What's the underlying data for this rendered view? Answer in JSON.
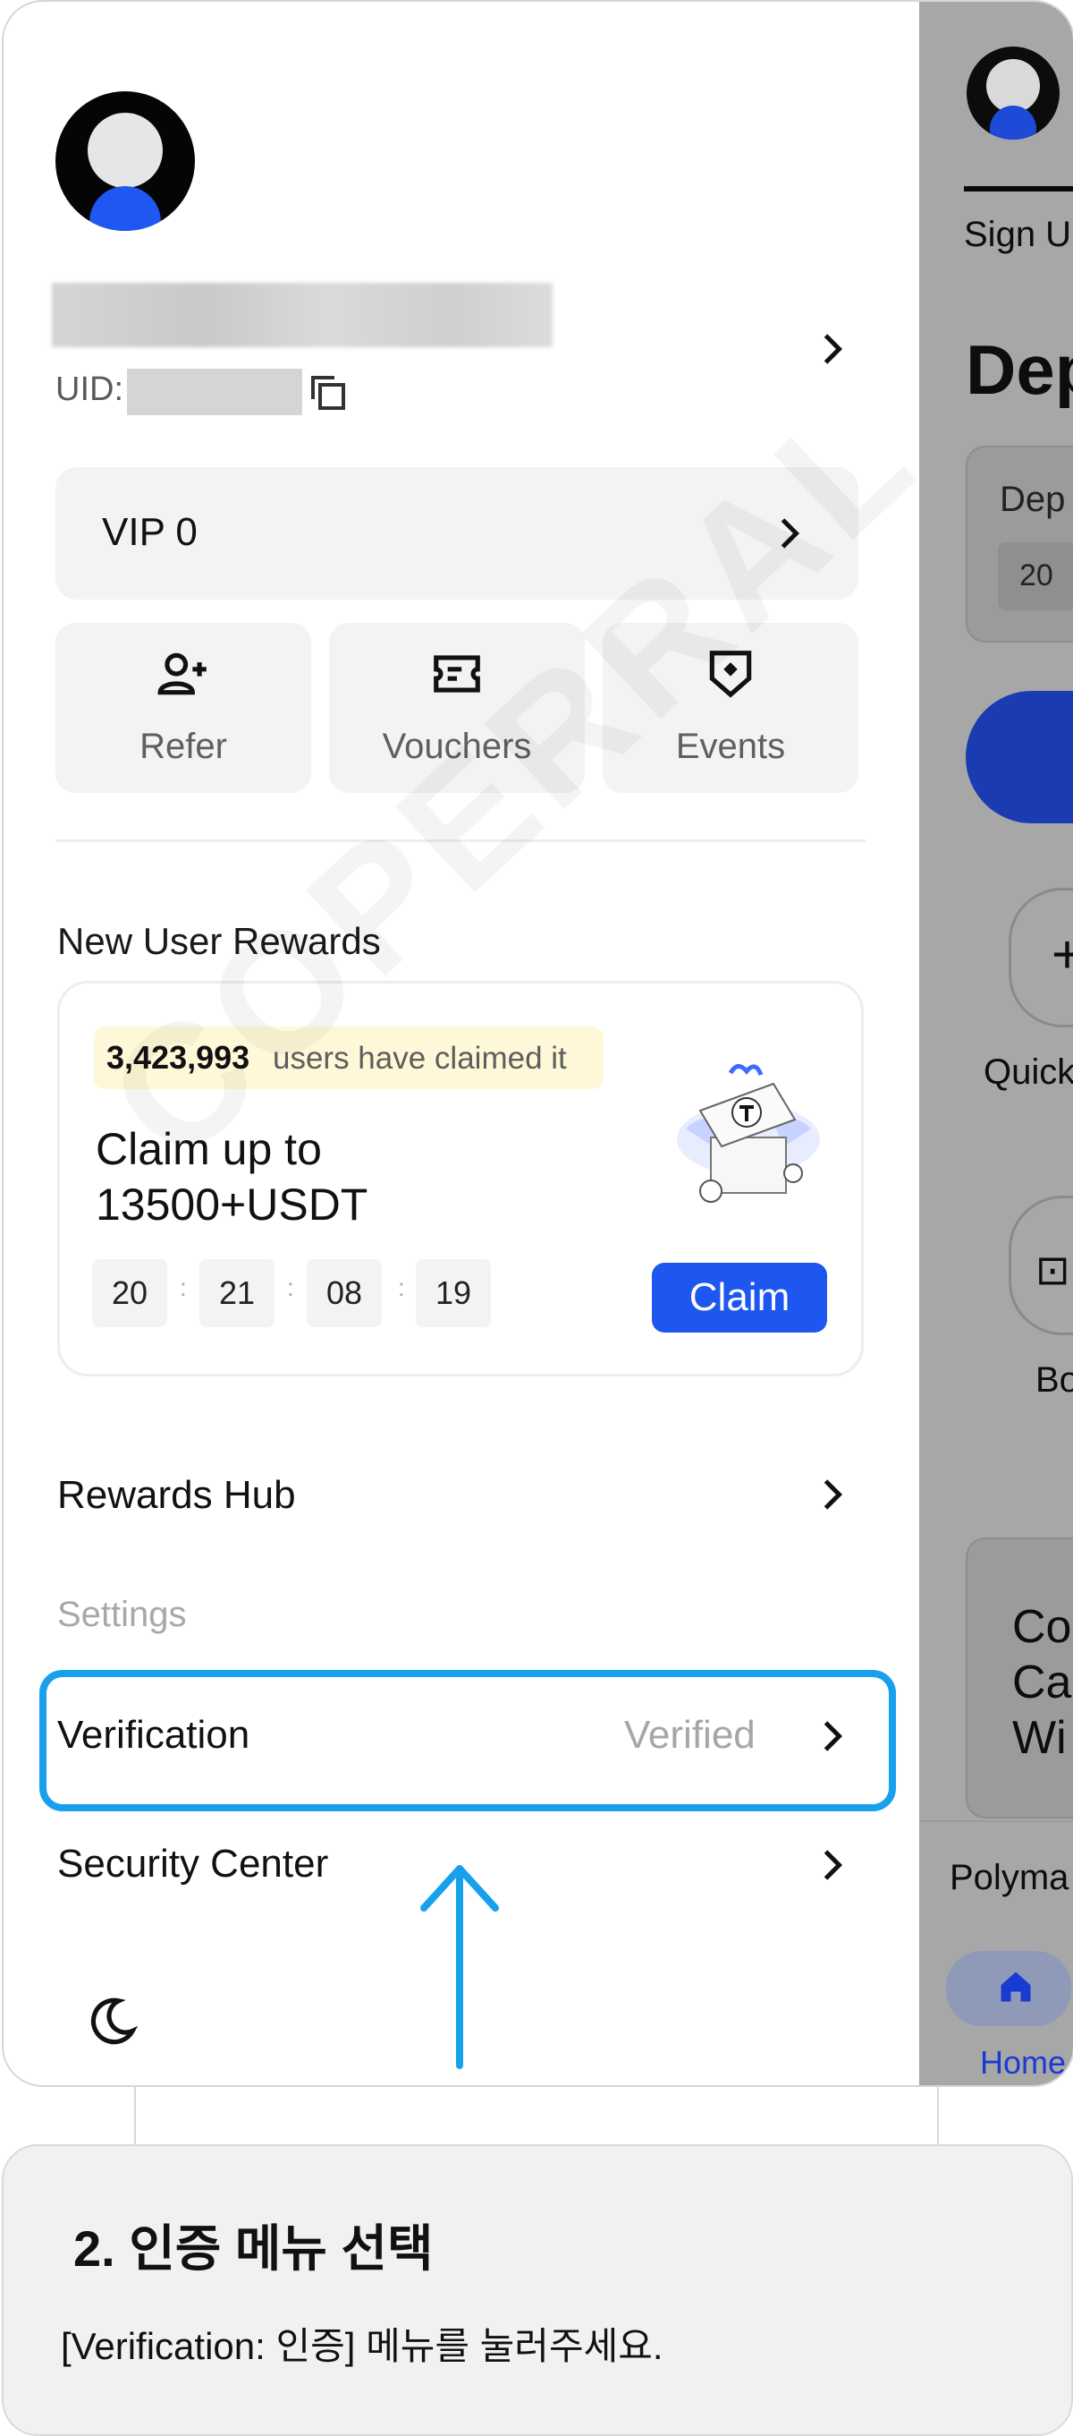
{
  "drawer": {
    "uid_label": "UID:",
    "vip_label": "VIP 0",
    "shortcuts": [
      {
        "label": "Refer",
        "icon": "user-plus-icon"
      },
      {
        "label": "Vouchers",
        "icon": "ticket-icon"
      },
      {
        "label": "Events",
        "icon": "badge-icon"
      }
    ],
    "new_user_rewards": {
      "title": "New User Rewards",
      "claimed_count": "3,423,993",
      "claimed_text": "users have claimed it",
      "headline": "Claim up to 13500+USDT",
      "timer": [
        "20",
        "21",
        "08",
        "19"
      ],
      "claim_button": "Claim"
    },
    "rewards_hub": "Rewards Hub",
    "settings_header": "Settings",
    "verification": {
      "label": "Verification",
      "status": "Verified"
    },
    "security_center": "Security Center"
  },
  "background_app": {
    "tab_label": "Sign Up",
    "heading": "Dep",
    "card_label": "Dep",
    "card_value": "20",
    "quick_label": "Quick",
    "bo_label": "Bo",
    "promo_lines": [
      "Co",
      "Ca",
      "Wi"
    ],
    "polymarket_label": "Polyma",
    "nav_home": "Home"
  },
  "caption": {
    "step_title": "2. 인증 메뉴 선택",
    "description": "[Verification: 인증] 메뉴를 눌러주세요."
  },
  "watermark": "COPERRAL",
  "colors": {
    "accent_blue": "#1d57ef",
    "highlight_blue": "#19a0ec",
    "overlay_gray": "#a7a7a7"
  }
}
